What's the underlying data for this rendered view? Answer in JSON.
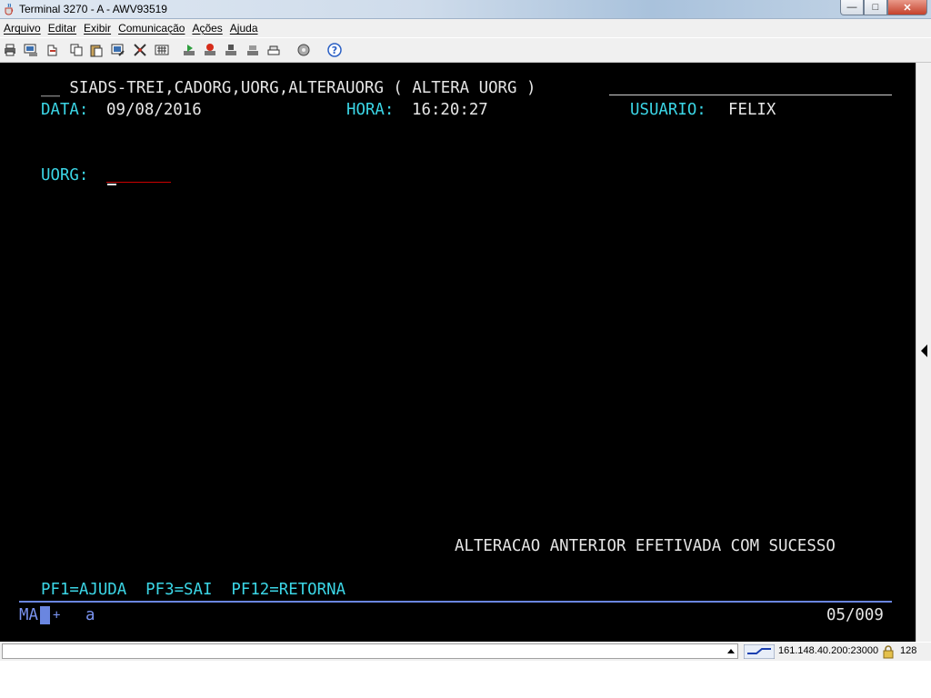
{
  "window": {
    "title": "Terminal 3270 - A - AWV93519",
    "controls": {
      "minimize": "—",
      "maximize": "□",
      "close": "✕"
    }
  },
  "menu": [
    "Arquivo",
    "Editar",
    "Exibir",
    "Comunicação",
    "Ações",
    "Ajuda"
  ],
  "toolbar_icons": [
    "print-icon",
    "copy-screen-icon",
    "transfer-icon",
    "copy-icon",
    "paste-icon",
    "edit-icon",
    "macro-icon",
    "keypad-icon",
    "play-macro-icon",
    "stop-macro-icon",
    "record-icon",
    "settings-icon",
    "printer-icon",
    "help-icon"
  ],
  "terminal": {
    "header_line": "__ SIADS-TREI,CADORG,UORG,ALTERAUORG ( ALTERA UORG )",
    "data_label": "DATA:",
    "data_value": "09/08/2016",
    "hora_label": "HORA:",
    "hora_value": "16:20:27",
    "usuario_label": "USUARIO:",
    "usuario_value": "FELIX",
    "uorg_label": "UORG:",
    "uorg_value": "",
    "message": "ALTERACAO ANTERIOR EFETIVADA COM SUCESSO",
    "pf_keys": "PF1=AJUDA  PF3=SAI  PF12=RETORNA",
    "oia_left": "MA",
    "oia_plus": "+",
    "oia_a": "a",
    "oia_cursor": "05/009"
  },
  "statusbar": {
    "address": "161.148.40.200:23000",
    "count": "128"
  },
  "colors": {
    "screen_bg": "#000000",
    "field_text": "#3bd6e6",
    "value_text": "#e6e6e6",
    "underline": "#cc0000"
  }
}
